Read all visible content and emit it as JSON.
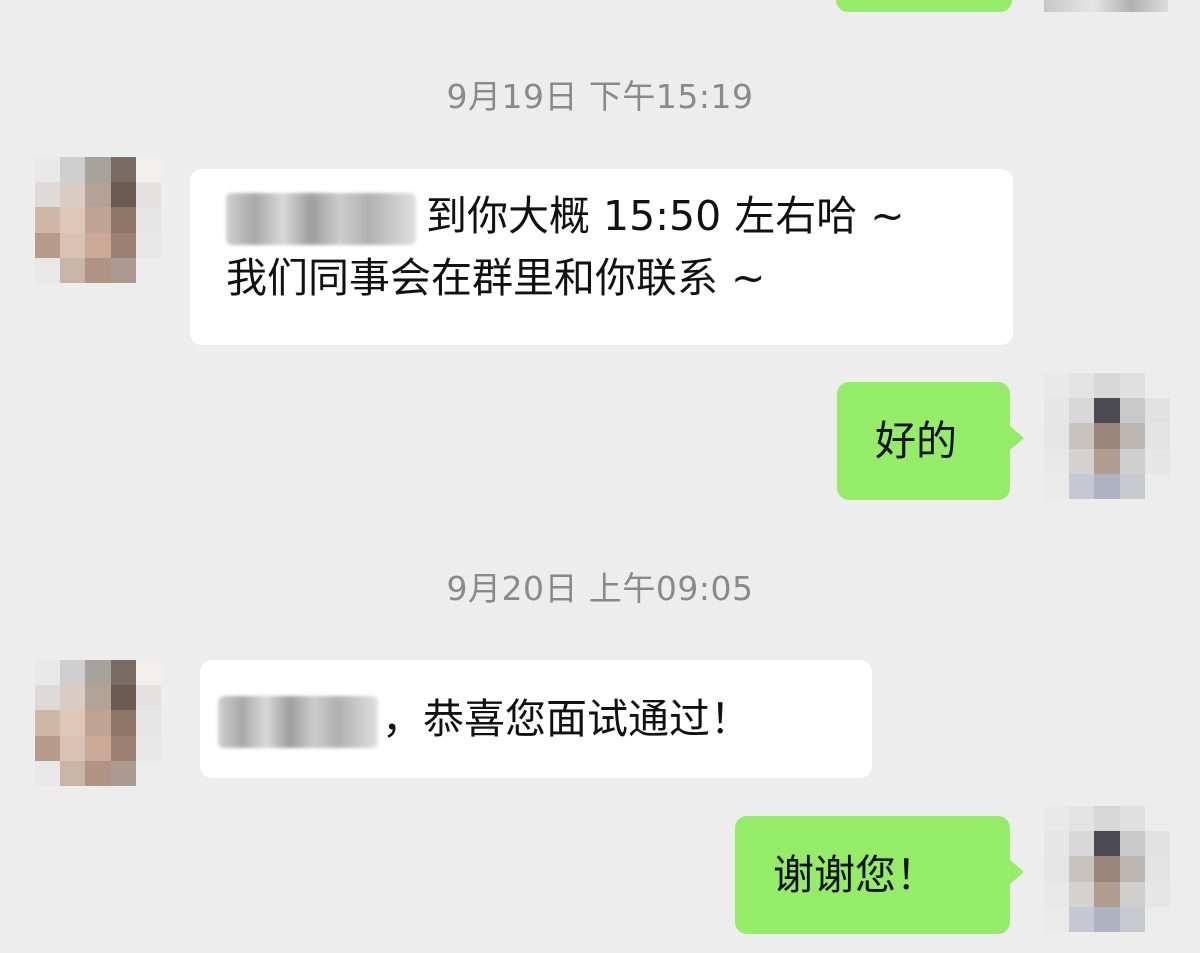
{
  "chat": {
    "messages": [
      {
        "type": "timestamp",
        "text": "9月19日 下午15:19"
      },
      {
        "type": "incoming",
        "line1": "到你大概 15:50 左右哈 ~",
        "line2": "我们同事会在群里和你联系 ~"
      },
      {
        "type": "outgoing",
        "text": "好的"
      },
      {
        "type": "timestamp",
        "text": "9月20日 上午09:05"
      },
      {
        "type": "incoming",
        "text": "，恭喜您面试通过！"
      },
      {
        "type": "outgoing",
        "text": "谢谢您！"
      }
    ]
  },
  "avatars": {
    "contact": [
      "#e9e9e9",
      "#cfcfcf",
      "#a8a29c",
      "#7a6b64",
      "#f0efee",
      "#dedad8",
      "#d8ccc4",
      "#b3a296",
      "#6b5a52",
      "#e4e2e1",
      "#cfb7a6",
      "#e0c8b8",
      "#c0a493",
      "#8c7466",
      "#e6e5e5",
      "#b89a89",
      "#d9c2b3",
      "#caa996",
      "#9c8172",
      "#e7e7e7",
      "#e8e8e8",
      "#c9b4a6",
      "#b09382",
      "#aa9a90",
      "#ececec"
    ],
    "self": [
      "#e9e9e9",
      "#e3e3e3",
      "#d7d7d7",
      "#e0e0e0",
      "#ececec",
      "#e6e6e6",
      "#d8d8d8",
      "#4a4a50",
      "#c9c9c9",
      "#e2e2e2",
      "#e5e5e5",
      "#c9c3bd",
      "#9a857a",
      "#bdb7b3",
      "#e4e4e4",
      "#e8e8e8",
      "#d6d2cf",
      "#b29d91",
      "#cfcfcf",
      "#e6e6e6",
      "#eaeaea",
      "#c5c8d2",
      "#aeb3c2",
      "#c8cad2",
      "#ececec"
    ]
  }
}
